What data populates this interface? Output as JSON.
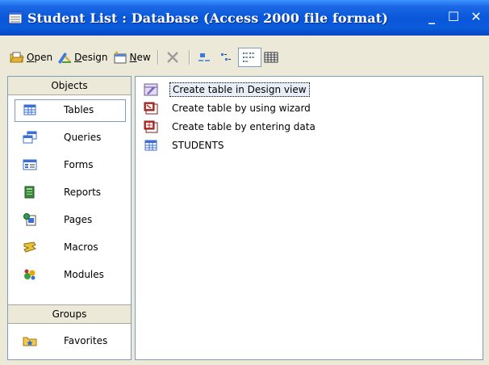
{
  "window": {
    "title": "Student List : Database (Access 2000 file format)",
    "minimize": "_",
    "maximize": "☐",
    "close": "✕"
  },
  "toolbar": {
    "open_accel": "O",
    "open_rest": "pen",
    "design_accel": "D",
    "design_rest": "esign",
    "new_accel": "N",
    "new_rest": "ew"
  },
  "objects_panel": {
    "objects_header": "Objects",
    "items": [
      {
        "label": "Tables",
        "icon": "table-icon"
      },
      {
        "label": "Queries",
        "icon": "query-icon"
      },
      {
        "label": "Forms",
        "icon": "form-icon"
      },
      {
        "label": "Reports",
        "icon": "report-icon"
      },
      {
        "label": "Pages",
        "icon": "page-icon"
      },
      {
        "label": "Macros",
        "icon": "macro-icon"
      },
      {
        "label": "Modules",
        "icon": "module-icon"
      }
    ],
    "groups_header": "Groups",
    "groups": [
      {
        "label": "Favorites",
        "icon": "favorites-folder-icon"
      }
    ],
    "selected": "Tables"
  },
  "object_list": [
    {
      "label": "Create table in Design view",
      "icon": "design-view-icon",
      "focused": true
    },
    {
      "label": "Create table by using wizard",
      "icon": "wizard-icon",
      "focused": false
    },
    {
      "label": "Create table by entering data",
      "icon": "datasheet-icon",
      "focused": false
    },
    {
      "label": "STUDENTS",
      "icon": "table-icon",
      "focused": false
    }
  ],
  "colors": {
    "titlebar": "#0958DA",
    "window_bg": "#ECE9D8",
    "border": "#7F9DB9"
  }
}
